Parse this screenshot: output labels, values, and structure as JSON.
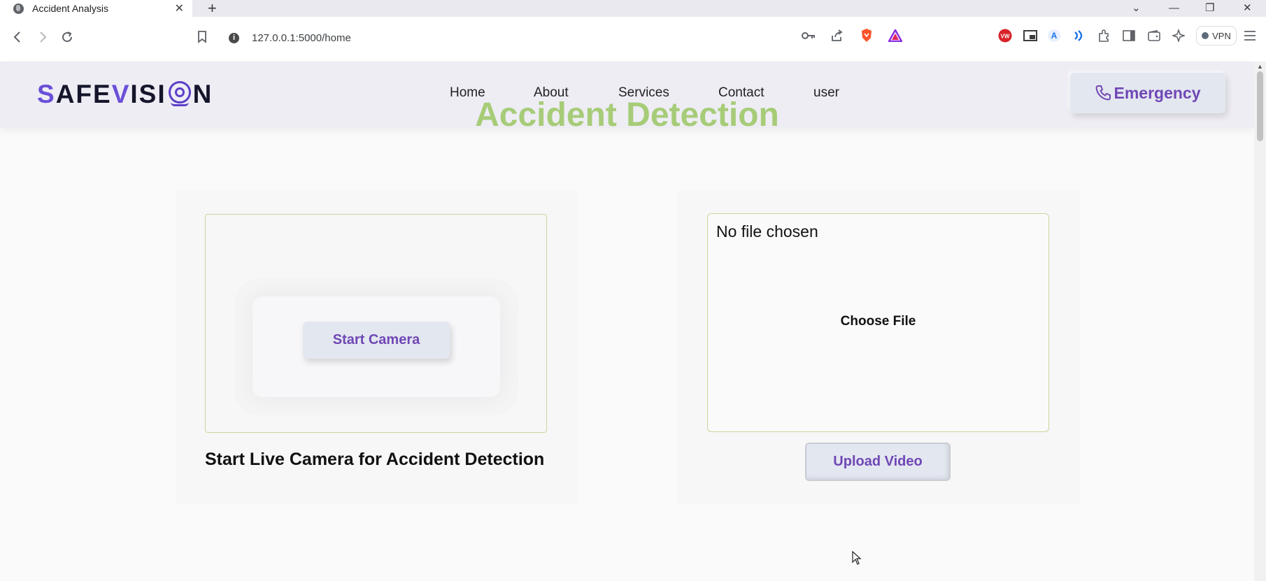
{
  "browser": {
    "tab_title": "Accident Analysis",
    "tab_close": "✕",
    "new_tab": "+",
    "url": "127.0.0.1:5000/home",
    "vpn_label": "VPN",
    "controls": {
      "chevron": "⌄",
      "minimize": "—",
      "restore": "❐",
      "close": "✕"
    }
  },
  "site": {
    "logo": {
      "prefix_s": "S",
      "afe": "AFE",
      "v": "V",
      "isi": "ISI",
      "n": "N"
    },
    "nav": [
      "Home",
      "About",
      "Services",
      "Contact",
      "user"
    ],
    "emergency_label": "Emergency"
  },
  "main": {
    "title": "Accident Detection",
    "camera": {
      "button_label": "Start Camera",
      "caption": "Start Live Camera for Accident Detection"
    },
    "upload": {
      "file_status": "No file chosen",
      "choose_label": "Choose File",
      "button_label": "Upload Video"
    }
  },
  "colors": {
    "accent_purple": "#7047b5",
    "title_green": "#a7cc78",
    "header_bg": "#eeedf4"
  }
}
